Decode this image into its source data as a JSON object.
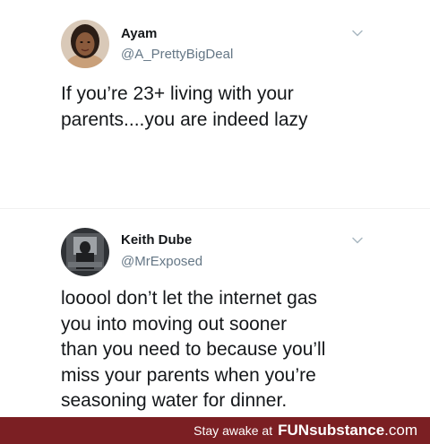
{
  "tweets": [
    {
      "author_name": "Ayam",
      "author_handle": "@A_PrettyBigDeal",
      "text_lines": [
        "If you’re 23+ living with your",
        "parents....you are indeed lazy"
      ],
      "avatar_icon": "avatar-photo-icon",
      "menu_icon": "chevron-down-icon"
    },
    {
      "author_name": "Keith Dube",
      "author_handle": "@MrExposed",
      "text_lines": [
        "looool don’t let the internet gas",
        "you into moving out sooner",
        "than you need to because you’ll",
        "miss your parents when you’re",
        "seasoning water for dinner."
      ],
      "avatar_icon": "avatar-photo-icon",
      "menu_icon": "chevron-down-icon"
    }
  ],
  "footer": {
    "text": "Stay awake at",
    "brand_bold": "FUN",
    "brand_rest": "substance",
    "brand_suffix": ".com",
    "background": "#7b1f23"
  },
  "colors": {
    "name": "#14171a",
    "handle": "#657786",
    "chevron": "#aab8c2"
  }
}
